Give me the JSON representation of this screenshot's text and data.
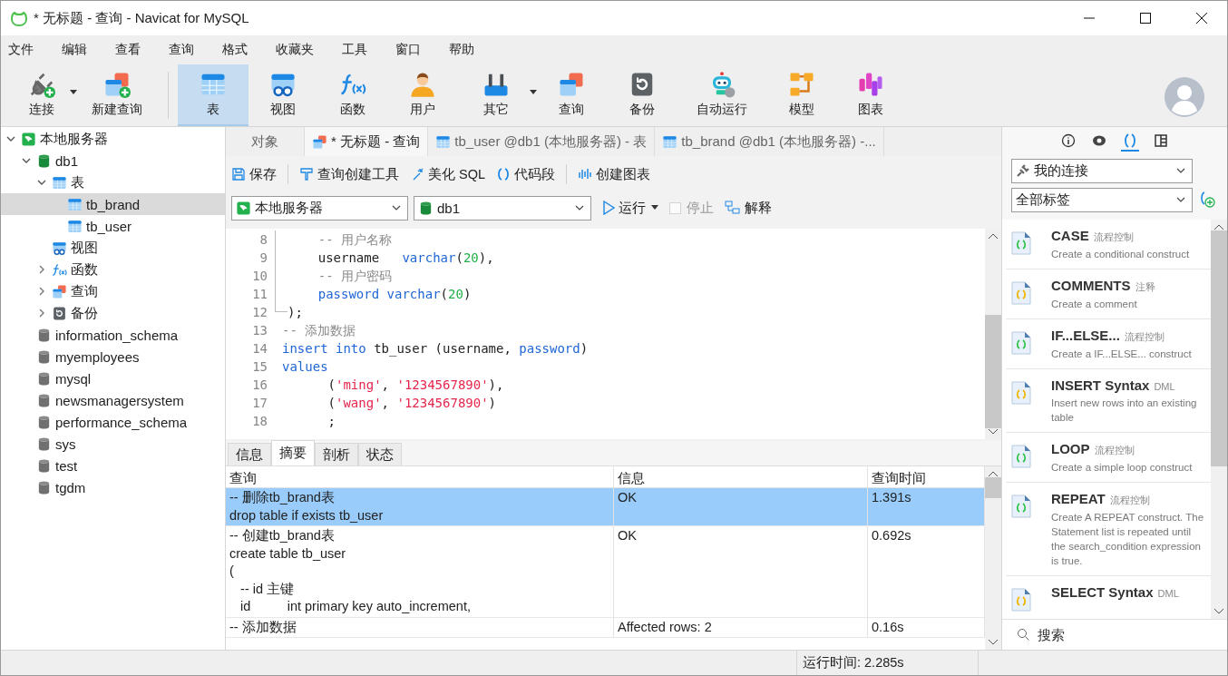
{
  "window": {
    "title": "* 无标题 - 查询 - Navicat for MySQL"
  },
  "menu": [
    "文件",
    "编辑",
    "查看",
    "查询",
    "格式",
    "收藏夹",
    "工具",
    "窗口",
    "帮助"
  ],
  "toolbar": [
    {
      "label": "连接",
      "kind": "connect",
      "selected": false,
      "has_menu": true
    },
    {
      "label": "新建查询",
      "kind": "new-query",
      "selected": false,
      "has_menu": false
    },
    {
      "label": "表",
      "kind": "table",
      "selected": true,
      "has_menu": false
    },
    {
      "label": "视图",
      "kind": "view",
      "selected": false,
      "has_menu": false
    },
    {
      "label": "函数",
      "kind": "function",
      "selected": false,
      "has_menu": false
    },
    {
      "label": "用户",
      "kind": "user",
      "selected": false,
      "has_menu": false
    },
    {
      "label": "其它",
      "kind": "tools",
      "selected": false,
      "has_menu": true
    },
    {
      "label": "查询",
      "kind": "query",
      "selected": false,
      "has_menu": false
    },
    {
      "label": "备份",
      "kind": "backup",
      "selected": false,
      "has_menu": false
    },
    {
      "label": "自动运行",
      "kind": "robot",
      "selected": false,
      "has_menu": false
    },
    {
      "label": "模型",
      "kind": "model",
      "selected": false,
      "has_menu": false
    },
    {
      "label": "图表",
      "kind": "chart",
      "selected": false,
      "has_menu": false
    }
  ],
  "tree": [
    {
      "label": "本地服务器",
      "kind": "server",
      "expanded": true,
      "selected": false,
      "children": [
        {
          "label": "db1",
          "kind": "database",
          "expanded": true,
          "selected": false,
          "children": [
            {
              "label": "表",
              "kind": "table",
              "expanded": true,
              "selected": false,
              "children": [
                {
                  "label": "tb_brand",
                  "kind": "table",
                  "selected": true
                },
                {
                  "label": "tb_user",
                  "kind": "table",
                  "selected": false
                }
              ]
            },
            {
              "label": "视图",
              "kind": "view",
              "selected": false
            },
            {
              "label": "函数",
              "kind": "function",
              "expanded": false,
              "selected": false
            },
            {
              "label": "查询",
              "kind": "query",
              "expanded": false,
              "selected": false
            },
            {
              "label": "备份",
              "kind": "backup",
              "expanded": false,
              "selected": false
            }
          ]
        },
        {
          "label": "information_schema",
          "kind": "database-off",
          "selected": false
        },
        {
          "label": "myemployees",
          "kind": "database-off",
          "selected": false
        },
        {
          "label": "mysql",
          "kind": "database-off",
          "selected": false
        },
        {
          "label": "newsmanagersystem",
          "kind": "database-off",
          "selected": false
        },
        {
          "label": "performance_schema",
          "kind": "database-off",
          "selected": false
        },
        {
          "label": "sys",
          "kind": "database-off",
          "selected": false
        },
        {
          "label": "test",
          "kind": "database-off",
          "selected": false
        },
        {
          "label": "tgdm",
          "kind": "database-off",
          "selected": false
        }
      ]
    }
  ],
  "tabs": [
    {
      "label": "对象",
      "kind": "plain",
      "selected": false
    },
    {
      "label": "* 无标题 - 查询",
      "kind": "query",
      "selected": true
    },
    {
      "label": "tb_user @db1 (本地服务器) - 表",
      "kind": "table",
      "selected": false
    },
    {
      "label": "tb_brand @db1 (本地服务器) -...",
      "kind": "table",
      "selected": false
    }
  ],
  "query_toolbar": [
    {
      "label": "保存",
      "kind": "save"
    },
    {
      "label": "查询创建工具",
      "kind": "builder"
    },
    {
      "label": "美化 SQL",
      "kind": "beautify"
    },
    {
      "label": "代码段",
      "kind": "snippet"
    },
    {
      "label": "创建图表",
      "kind": "chart"
    }
  ],
  "connection_select": "本地服务器",
  "database_select": "db1",
  "run": {
    "label": "运行"
  },
  "stop": {
    "label": "停止",
    "checked": false,
    "disabled": true
  },
  "explain": {
    "label": "解释"
  },
  "editor": [
    {
      "number": "8",
      "fold": true,
      "tokens": [
        {
          "text": "    -- 用户名称",
          "kind": "comment"
        }
      ]
    },
    {
      "number": "9",
      "fold": true,
      "tokens": [
        {
          "text": "    username   ",
          "kind": "plain"
        },
        {
          "text": "varchar",
          "kind": "keyword"
        },
        {
          "text": "(",
          "kind": "plain"
        },
        {
          "text": "20",
          "kind": "number"
        },
        {
          "text": "),",
          "kind": "plain"
        }
      ]
    },
    {
      "number": "10",
      "fold": true,
      "tokens": [
        {
          "text": "    -- 用户密码",
          "kind": "comment"
        }
      ]
    },
    {
      "number": "11",
      "fold": true,
      "tokens": [
        {
          "text": "    password",
          "kind": "keyword"
        },
        {
          "text": " varchar",
          "kind": "keyword"
        },
        {
          "text": "(",
          "kind": "plain"
        },
        {
          "text": "20",
          "kind": "number"
        },
        {
          "text": ")",
          "kind": "plain"
        }
      ]
    },
    {
      "number": "12",
      "fold": true,
      "tokens": [
        {
          "text": ");",
          "kind": "plain"
        }
      ]
    },
    {
      "number": "13",
      "fold": false,
      "tokens": [
        {
          "text": "-- 添加数据",
          "kind": "comment"
        }
      ]
    },
    {
      "number": "14",
      "fold": false,
      "tokens": [
        {
          "text": "insert into",
          "kind": "keyword"
        },
        {
          "text": " tb_user (username, ",
          "kind": "plain"
        },
        {
          "text": "password",
          "kind": "keyword"
        },
        {
          "text": ")",
          "kind": "plain"
        }
      ]
    },
    {
      "number": "15",
      "fold": false,
      "tokens": [
        {
          "text": "values",
          "kind": "keyword"
        }
      ]
    },
    {
      "number": "16",
      "fold": false,
      "tokens": [
        {
          "text": "      (",
          "kind": "plain"
        },
        {
          "text": "'ming'",
          "kind": "string"
        },
        {
          "text": ", ",
          "kind": "plain"
        },
        {
          "text": "'1234567890'",
          "kind": "string"
        },
        {
          "text": "),",
          "kind": "plain"
        }
      ]
    },
    {
      "number": "17",
      "fold": false,
      "tokens": [
        {
          "text": "      (",
          "kind": "plain"
        },
        {
          "text": "'wang'",
          "kind": "string"
        },
        {
          "text": ", ",
          "kind": "plain"
        },
        {
          "text": "'1234567890'",
          "kind": "string"
        },
        {
          "text": ")",
          "kind": "plain"
        }
      ]
    },
    {
      "number": "18",
      "fold": false,
      "tokens": [
        {
          "text": "      ;",
          "kind": "plain"
        }
      ]
    }
  ],
  "result_tabs": [
    {
      "label": "信息",
      "selected": false
    },
    {
      "label": "摘要",
      "selected": true
    },
    {
      "label": "剖析",
      "selected": false
    },
    {
      "label": "状态",
      "selected": false
    }
  ],
  "result_table": {
    "columns": [
      "查询",
      "信息",
      "查询时间"
    ],
    "rows": [
      {
        "query": [
          "-- 删除tb_brand表",
          "drop table if exists tb_user"
        ],
        "info": "OK",
        "time": "1.391s",
        "selected": true
      },
      {
        "query": [
          "-- 创建tb_brand表",
          "create table tb_user",
          "(",
          "   -- id 主键",
          "   id          int primary key auto_increment,"
        ],
        "info": "OK",
        "time": "0.692s",
        "selected": false
      },
      {
        "query": [
          "-- 添加数据"
        ],
        "info": "Affected rows: 2",
        "time": "0.16s",
        "selected": false
      }
    ]
  },
  "side_tabs": [
    {
      "kind": "info",
      "selected": false
    },
    {
      "kind": "preview",
      "selected": false
    },
    {
      "kind": "snippet",
      "selected": true
    },
    {
      "kind": "grid",
      "selected": false
    }
  ],
  "connection_filter": "我的连接",
  "tag_filter": "全部标签",
  "snippets": [
    {
      "title": "CASE",
      "tag": "流程控制",
      "description": "Create a conditional construct",
      "color": "#2fc24a"
    },
    {
      "title": "COMMENTS",
      "tag": "注释",
      "description": "Create a comment",
      "color": "#f0b400"
    },
    {
      "title": "IF...ELSE...",
      "tag": "流程控制",
      "description": "Create a IF...ELSE... construct",
      "color": "#2fc24a"
    },
    {
      "title": "INSERT Syntax",
      "tag": "DML",
      "description": "Insert new rows into an existing table",
      "color": "#f0b400"
    },
    {
      "title": "LOOP",
      "tag": "流程控制",
      "description": "Create a simple loop construct",
      "color": "#2fc24a"
    },
    {
      "title": "REPEAT",
      "tag": "流程控制",
      "description": "Create A REPEAT construct. The Statement list is repeated until the search_condition expression is true.",
      "color": "#2fc24a"
    },
    {
      "title": "SELECT Syntax",
      "tag": "DML",
      "color": "#f0b400"
    }
  ],
  "search": {
    "placeholder": "搜索"
  },
  "status_bar": {
    "run_time": "运行时间: 2.285s"
  }
}
